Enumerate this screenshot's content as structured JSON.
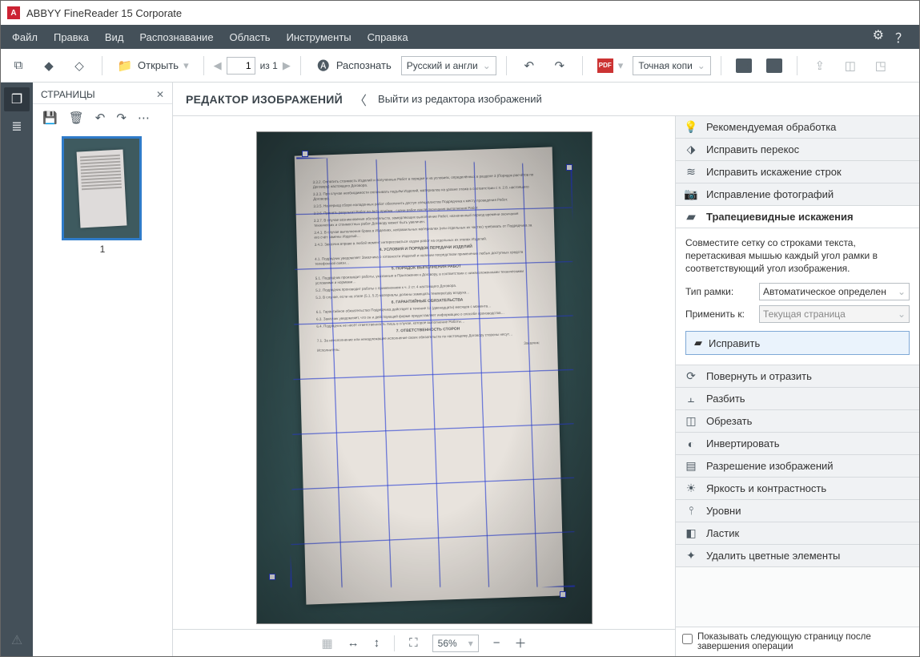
{
  "title": "ABBYY FineReader 15 Corporate",
  "menu": [
    "Файл",
    "Правка",
    "Вид",
    "Распознавание",
    "Область",
    "Инструменты",
    "Справка"
  ],
  "toolbar": {
    "open": "Открыть",
    "page_value": "1",
    "page_of": "из 1",
    "recognize": "Распознать",
    "lang": "Русский и англи",
    "save_mode": "Точная копи",
    "pdf_label": "PDF"
  },
  "pages_panel": {
    "title": "СТРАНИЦЫ",
    "thumb_num": "1"
  },
  "editor": {
    "title": "РЕДАКТОР ИЗОБРАЖЕНИЙ",
    "exit": "Выйти из редактора изображений"
  },
  "right_tools_top": [
    "Рекомендуемая обработка",
    "Исправить перекос",
    "Исправить искажение строк",
    "Исправление фотографий",
    "Трапециевидные искажения"
  ],
  "trap": {
    "desc": "Совместите сетку со строками текста, перетаскивая мышью каждый угол рамки в соответствующий угол изображения.",
    "frame_label": "Тип рамки:",
    "frame_value": "Автоматическое определен",
    "apply_to_label": "Применить к:",
    "apply_to_value": "Текущая страница",
    "apply_btn": "Исправить"
  },
  "right_tools_bottom": [
    "Повернуть и отразить",
    "Разбить",
    "Обрезать",
    "Инвертировать",
    "Разрешение изображений",
    "Яркость и контрастность",
    "Уровни",
    "Ластик",
    "Удалить цветные элементы"
  ],
  "zoom": "56%",
  "footer_check": "Показывать следующую страницу после завершения операции"
}
